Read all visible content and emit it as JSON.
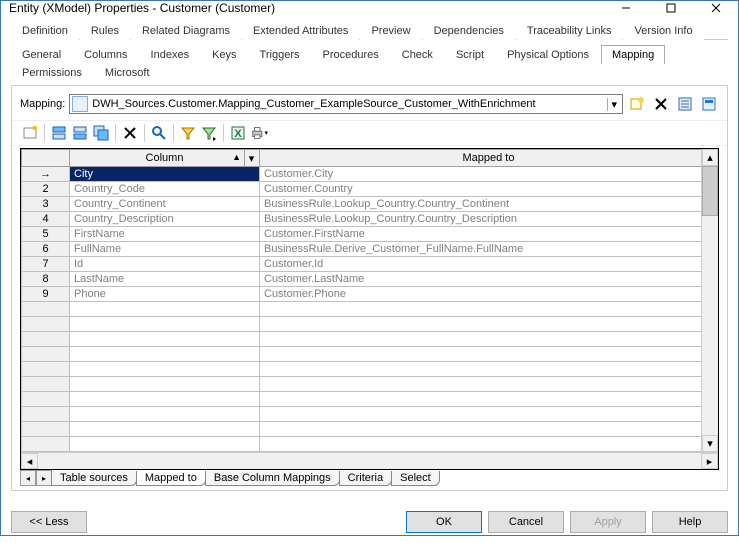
{
  "window": {
    "title": "Entity (XModel) Properties - Customer (Customer)"
  },
  "tabs_row1": [
    "Definition",
    "Rules",
    "Related Diagrams",
    "Extended Attributes",
    "Preview",
    "Dependencies",
    "Traceability Links",
    "Version Info"
  ],
  "tabs_row2": [
    "General",
    "Columns",
    "Indexes",
    "Keys",
    "Triggers",
    "Procedures",
    "Check",
    "Script",
    "Physical Options",
    "Mapping",
    "Permissions",
    "Microsoft"
  ],
  "active_tab": "Mapping",
  "mapping": {
    "label": "Mapping:",
    "value": "DWH_Sources.Customer.Mapping_Customer_ExampleSource_Customer_WithEnrichment"
  },
  "grid": {
    "col1": "Column",
    "col2": "Mapped to",
    "rows": [
      {
        "n": "→",
        "c": "City",
        "m": "Customer.City",
        "sel": true
      },
      {
        "n": "2",
        "c": "Country_Code",
        "m": "Customer.Country"
      },
      {
        "n": "3",
        "c": "Country_Continent",
        "m": "BusinessRule.Lookup_Country.Country_Continent"
      },
      {
        "n": "4",
        "c": "Country_Description",
        "m": "BusinessRule.Lookup_Country.Country_Description"
      },
      {
        "n": "5",
        "c": "FirstName",
        "m": "Customer.FirstName"
      },
      {
        "n": "6",
        "c": "FullName",
        "m": "BusinessRule.Derive_Customer_FullName.FullName"
      },
      {
        "n": "7",
        "c": "Id",
        "m": "Customer.Id"
      },
      {
        "n": "8",
        "c": "LastName",
        "m": "Customer.LastName"
      },
      {
        "n": "9",
        "c": "Phone",
        "m": "Customer.Phone"
      }
    ]
  },
  "bottom_tabs": [
    "Table sources",
    "Mapped to",
    "Base Column Mappings",
    "Criteria",
    "Select"
  ],
  "active_bottom_tab": "Mapped to",
  "footer": {
    "less": "<< Less",
    "ok": "OK",
    "cancel": "Cancel",
    "apply": "Apply",
    "help": "Help"
  }
}
